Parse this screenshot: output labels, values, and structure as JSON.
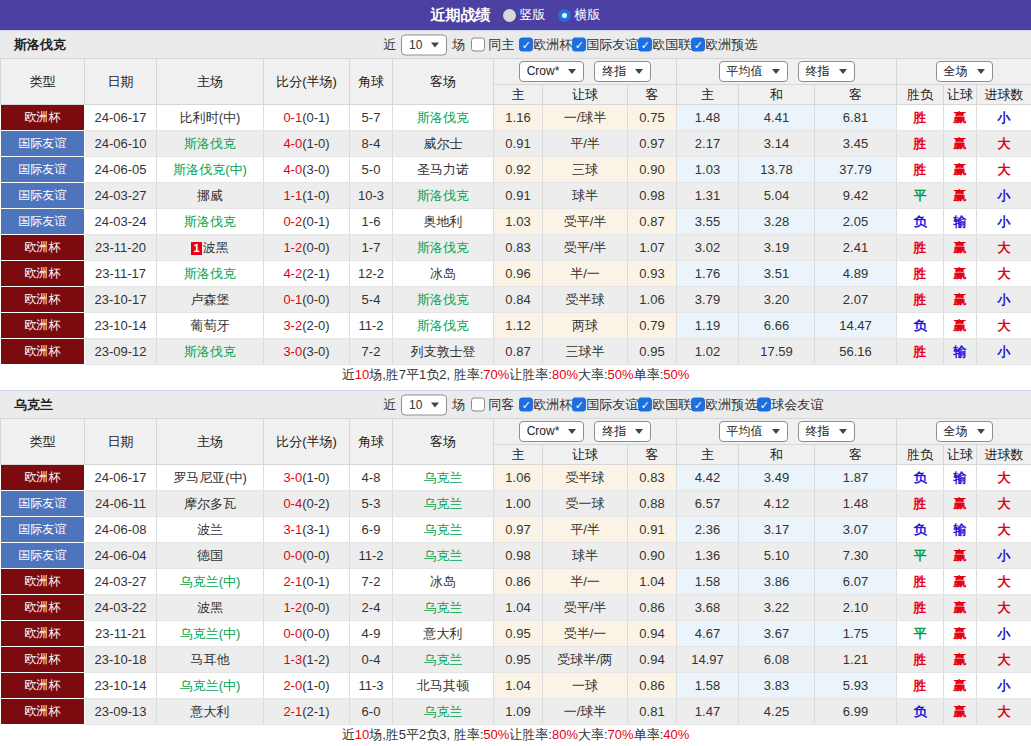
{
  "topbar": {
    "title": "近期战绩",
    "radios": [
      {
        "label": "竖版",
        "checked": false
      },
      {
        "label": "横版",
        "checked": true
      }
    ]
  },
  "colors": {
    "type": {
      "欧洲杯": "#7b0b0e",
      "国际友谊": "#4e74bc"
    },
    "result": {
      "胜": "#e60012",
      "平": "#009944",
      "负": "#1a16d8",
      "赢": "#e60012",
      "输": "#1a16d8",
      "大": "#e60012",
      "小": "#1a16d8"
    },
    "focus_team": "#00a44e",
    "score": "#e60012",
    "accent_blue": "#1b6fe0",
    "topbar_purple": "#4c41a3"
  },
  "table_header": {
    "main_cols": [
      "类型",
      "日期",
      "主场",
      "比分(半场)",
      "角球",
      "客场"
    ],
    "group1_selects": [
      "Crow*",
      "终指"
    ],
    "group2_selects": [
      "平均值",
      "终指"
    ],
    "group3_selects": [
      "全场"
    ],
    "sub_cols": [
      "主",
      "让球",
      "客",
      "主",
      "和",
      "客",
      "胜负",
      "让球",
      "进球数"
    ]
  },
  "sections": [
    {
      "team": "斯洛伐克",
      "filter": {
        "near_label": "近",
        "count": "10",
        "field_label": "场",
        "same_label": "同主",
        "same_checked": false,
        "competitions": [
          {
            "label": "欧洲杯",
            "checked": true
          },
          {
            "label": "国际友谊",
            "checked": true
          },
          {
            "label": "欧国联",
            "checked": true
          },
          {
            "label": "欧洲预选",
            "checked": true
          }
        ]
      },
      "rows": [
        {
          "type": "欧洲杯",
          "date": "24-06-17",
          "home": "比利时(中)",
          "home_focus": false,
          "home_badge": "",
          "score": "0-1",
          "half": "(0-1)",
          "corner": "5-7",
          "away": "斯洛伐克",
          "away_focus": true,
          "odds1": [
            "1.16",
            "一/球半",
            "0.75"
          ],
          "odds2": [
            "1.48",
            "4.41",
            "6.81"
          ],
          "results": [
            "胜",
            "赢",
            "小"
          ]
        },
        {
          "type": "国际友谊",
          "date": "24-06-10",
          "home": "斯洛伐克",
          "home_focus": true,
          "home_badge": "",
          "score": "4-0",
          "half": "(1-0)",
          "corner": "8-4",
          "away": "威尔士",
          "away_focus": false,
          "odds1": [
            "0.91",
            "平/半",
            "0.97"
          ],
          "odds2": [
            "2.17",
            "3.14",
            "3.45"
          ],
          "results": [
            "胜",
            "赢",
            "大"
          ]
        },
        {
          "type": "国际友谊",
          "date": "24-06-05",
          "home": "斯洛伐克(中)",
          "home_focus": true,
          "home_badge": "",
          "score": "4-0",
          "half": "(3-0)",
          "corner": "5-0",
          "away": "圣马力诺",
          "away_focus": false,
          "odds1": [
            "0.92",
            "三球",
            "0.90"
          ],
          "odds2": [
            "1.03",
            "13.78",
            "37.79"
          ],
          "results": [
            "胜",
            "赢",
            "大"
          ]
        },
        {
          "type": "国际友谊",
          "date": "24-03-27",
          "home": "挪威",
          "home_focus": false,
          "home_badge": "",
          "score": "1-1",
          "half": "(1-0)",
          "corner": "10-3",
          "away": "斯洛伐克",
          "away_focus": true,
          "odds1": [
            "0.91",
            "球半",
            "0.98"
          ],
          "odds2": [
            "1.31",
            "5.04",
            "9.42"
          ],
          "results": [
            "平",
            "赢",
            "小"
          ]
        },
        {
          "type": "国际友谊",
          "date": "24-03-24",
          "home": "斯洛伐克",
          "home_focus": true,
          "home_badge": "",
          "score": "0-2",
          "half": "(0-1)",
          "corner": "1-6",
          "away": "奥地利",
          "away_focus": false,
          "odds1": [
            "1.03",
            "受平/半",
            "0.87"
          ],
          "odds2": [
            "3.55",
            "3.28",
            "2.05"
          ],
          "results": [
            "负",
            "输",
            "小"
          ]
        },
        {
          "type": "欧洲杯",
          "date": "23-11-20",
          "home": "波黑",
          "home_focus": false,
          "home_badge": "1",
          "score": "1-2",
          "half": "(0-0)",
          "corner": "1-7",
          "away": "斯洛伐克",
          "away_focus": true,
          "odds1": [
            "0.83",
            "受平/半",
            "1.07"
          ],
          "odds2": [
            "3.02",
            "3.19",
            "2.41"
          ],
          "results": [
            "胜",
            "赢",
            "大"
          ]
        },
        {
          "type": "欧洲杯",
          "date": "23-11-17",
          "home": "斯洛伐克",
          "home_focus": true,
          "home_badge": "",
          "score": "4-2",
          "half": "(2-1)",
          "corner": "12-2",
          "away": "冰岛",
          "away_focus": false,
          "odds1": [
            "0.96",
            "半/一",
            "0.93"
          ],
          "odds2": [
            "1.76",
            "3.51",
            "4.89"
          ],
          "results": [
            "胜",
            "赢",
            "大"
          ]
        },
        {
          "type": "欧洲杯",
          "date": "23-10-17",
          "home": "卢森堡",
          "home_focus": false,
          "home_badge": "",
          "score": "0-1",
          "half": "(0-0)",
          "corner": "5-4",
          "away": "斯洛伐克",
          "away_focus": true,
          "odds1": [
            "0.84",
            "受半球",
            "1.06"
          ],
          "odds2": [
            "3.79",
            "3.20",
            "2.07"
          ],
          "results": [
            "胜",
            "赢",
            "小"
          ]
        },
        {
          "type": "欧洲杯",
          "date": "23-10-14",
          "home": "葡萄牙",
          "home_focus": false,
          "home_badge": "",
          "score": "3-2",
          "half": "(2-0)",
          "corner": "11-2",
          "away": "斯洛伐克",
          "away_focus": true,
          "odds1": [
            "1.12",
            "两球",
            "0.79"
          ],
          "odds2": [
            "1.19",
            "6.66",
            "14.47"
          ],
          "results": [
            "负",
            "赢",
            "大"
          ]
        },
        {
          "type": "欧洲杯",
          "date": "23-09-12",
          "home": "斯洛伐克",
          "home_focus": true,
          "home_badge": "",
          "score": "3-0",
          "half": "(3-0)",
          "corner": "7-2",
          "away": "列支敦士登",
          "away_focus": false,
          "odds1": [
            "0.87",
            "三球半",
            "0.95"
          ],
          "odds2": [
            "1.02",
            "17.59",
            "56.16"
          ],
          "results": [
            "胜",
            "输",
            "小"
          ]
        }
      ],
      "summary": [
        {
          "text": "近",
          "red": false
        },
        {
          "text": "10",
          "red": true
        },
        {
          "text": "场,胜7平1负2, 胜率:",
          "red": false
        },
        {
          "text": "70%",
          "red": true
        },
        {
          "text": " 让胜率:",
          "red": false
        },
        {
          "text": "80%",
          "red": true
        },
        {
          "text": " 大率:",
          "red": false
        },
        {
          "text": "50%",
          "red": true
        },
        {
          "text": " 单率:",
          "red": false
        },
        {
          "text": "50%",
          "red": true
        }
      ]
    },
    {
      "team": "乌克兰",
      "filter": {
        "near_label": "近",
        "count": "10",
        "field_label": "场",
        "same_label": "同客",
        "same_checked": false,
        "competitions": [
          {
            "label": "欧洲杯",
            "checked": true
          },
          {
            "label": "国际友谊",
            "checked": true
          },
          {
            "label": "欧国联",
            "checked": true
          },
          {
            "label": "欧洲预选",
            "checked": true
          },
          {
            "label": "球会友谊",
            "checked": true
          }
        ]
      },
      "rows": [
        {
          "type": "欧洲杯",
          "date": "24-06-17",
          "home": "罗马尼亚(中)",
          "home_focus": false,
          "home_badge": "",
          "score": "3-0",
          "half": "(1-0)",
          "corner": "4-8",
          "away": "乌克兰",
          "away_focus": true,
          "odds1": [
            "1.06",
            "受半球",
            "0.83"
          ],
          "odds2": [
            "4.42",
            "3.49",
            "1.87"
          ],
          "results": [
            "负",
            "输",
            "大"
          ]
        },
        {
          "type": "国际友谊",
          "date": "24-06-11",
          "home": "摩尔多瓦",
          "home_focus": false,
          "home_badge": "",
          "score": "0-4",
          "half": "(0-2)",
          "corner": "5-3",
          "away": "乌克兰",
          "away_focus": true,
          "odds1": [
            "1.00",
            "受一球",
            "0.88"
          ],
          "odds2": [
            "6.57",
            "4.12",
            "1.48"
          ],
          "results": [
            "胜",
            "赢",
            "大"
          ]
        },
        {
          "type": "国际友谊",
          "date": "24-06-08",
          "home": "波兰",
          "home_focus": false,
          "home_badge": "",
          "score": "3-1",
          "half": "(3-1)",
          "corner": "6-9",
          "away": "乌克兰",
          "away_focus": true,
          "odds1": [
            "0.97",
            "平/半",
            "0.91"
          ],
          "odds2": [
            "2.36",
            "3.17",
            "3.07"
          ],
          "results": [
            "负",
            "输",
            "大"
          ]
        },
        {
          "type": "国际友谊",
          "date": "24-06-04",
          "home": "德国",
          "home_focus": false,
          "home_badge": "",
          "score": "0-0",
          "half": "(0-0)",
          "corner": "11-2",
          "away": "乌克兰",
          "away_focus": true,
          "odds1": [
            "0.98",
            "球半",
            "0.90"
          ],
          "odds2": [
            "1.36",
            "5.10",
            "7.30"
          ],
          "results": [
            "平",
            "赢",
            "小"
          ]
        },
        {
          "type": "欧洲杯",
          "date": "24-03-27",
          "home": "乌克兰(中)",
          "home_focus": true,
          "home_badge": "",
          "score": "2-1",
          "half": "(0-1)",
          "corner": "7-2",
          "away": "冰岛",
          "away_focus": false,
          "odds1": [
            "0.86",
            "半/一",
            "1.04"
          ],
          "odds2": [
            "1.58",
            "3.86",
            "6.07"
          ],
          "results": [
            "胜",
            "赢",
            "大"
          ]
        },
        {
          "type": "欧洲杯",
          "date": "24-03-22",
          "home": "波黑",
          "home_focus": false,
          "home_badge": "",
          "score": "1-2",
          "half": "(0-0)",
          "corner": "2-4",
          "away": "乌克兰",
          "away_focus": true,
          "odds1": [
            "1.04",
            "受平/半",
            "0.86"
          ],
          "odds2": [
            "3.68",
            "3.22",
            "2.10"
          ],
          "results": [
            "胜",
            "赢",
            "大"
          ]
        },
        {
          "type": "欧洲杯",
          "date": "23-11-21",
          "home": "乌克兰(中)",
          "home_focus": true,
          "home_badge": "",
          "score": "0-0",
          "half": "(0-0)",
          "corner": "4-9",
          "away": "意大利",
          "away_focus": false,
          "odds1": [
            "0.95",
            "受半/一",
            "0.94"
          ],
          "odds2": [
            "4.67",
            "3.67",
            "1.75"
          ],
          "results": [
            "平",
            "赢",
            "小"
          ]
        },
        {
          "type": "欧洲杯",
          "date": "23-10-18",
          "home": "马耳他",
          "home_focus": false,
          "home_badge": "",
          "score": "1-3",
          "half": "(1-2)",
          "corner": "0-4",
          "away": "乌克兰",
          "away_focus": true,
          "odds1": [
            "0.95",
            "受球半/两",
            "0.94"
          ],
          "odds2": [
            "14.97",
            "6.08",
            "1.21"
          ],
          "results": [
            "胜",
            "赢",
            "大"
          ]
        },
        {
          "type": "欧洲杯",
          "date": "23-10-14",
          "home": "乌克兰(中)",
          "home_focus": true,
          "home_badge": "",
          "score": "2-0",
          "half": "(1-0)",
          "corner": "11-3",
          "away": "北马其顿",
          "away_focus": false,
          "odds1": [
            "1.04",
            "一球",
            "0.86"
          ],
          "odds2": [
            "1.58",
            "3.83",
            "5.93"
          ],
          "results": [
            "胜",
            "赢",
            "小"
          ]
        },
        {
          "type": "欧洲杯",
          "date": "23-09-13",
          "home": "意大利",
          "home_focus": false,
          "home_badge": "",
          "score": "2-1",
          "half": "(2-1)",
          "corner": "6-0",
          "away": "乌克兰",
          "away_focus": true,
          "odds1": [
            "1.09",
            "一/球半",
            "0.81"
          ],
          "odds2": [
            "1.47",
            "4.25",
            "6.99"
          ],
          "results": [
            "负",
            "赢",
            "大"
          ]
        }
      ],
      "summary": [
        {
          "text": "近",
          "red": false
        },
        {
          "text": "10",
          "red": true
        },
        {
          "text": "场,胜5平2负3, 胜率:",
          "red": false
        },
        {
          "text": "50%",
          "red": true
        },
        {
          "text": " 让胜率:",
          "red": false
        },
        {
          "text": "80%",
          "red": true
        },
        {
          "text": " 大率:",
          "red": false
        },
        {
          "text": "70%",
          "red": true
        },
        {
          "text": " 单率:",
          "red": false
        },
        {
          "text": "40%",
          "red": true
        }
      ]
    }
  ]
}
